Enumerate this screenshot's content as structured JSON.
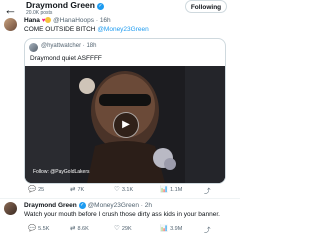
{
  "header": {
    "name": "Draymond Green",
    "posts": "20.0K posts",
    "follow_label": "Following"
  },
  "post1": {
    "author": "Hana",
    "handle": "@HanaHoops",
    "time": "· 16h",
    "text_prefix": "COME OUTSIDE BITCH",
    "mention": "@Money23Green"
  },
  "quote": {
    "handle": "@hyattwatcher",
    "time": "· 18h",
    "text": "Draymond quiet ASFFFF",
    "video_caption": "Follow: @PayGoldLakers"
  },
  "post1_actions": {
    "replies": "25",
    "reposts": "7K",
    "likes": "3.1K",
    "views": "1.1M"
  },
  "post2": {
    "author": "Draymond Green",
    "handle": "@Money23Green",
    "time": "· 2h",
    "text": "Watch your mouth before I crush those dirty ass kids in your banner."
  },
  "post2_actions": {
    "replies": "5.5K",
    "reposts": "8.6K",
    "likes": "29K",
    "views": "3.9M"
  },
  "colors": {
    "accent": "#1d9bf0",
    "muted": "#536471",
    "like": "#f91880"
  }
}
